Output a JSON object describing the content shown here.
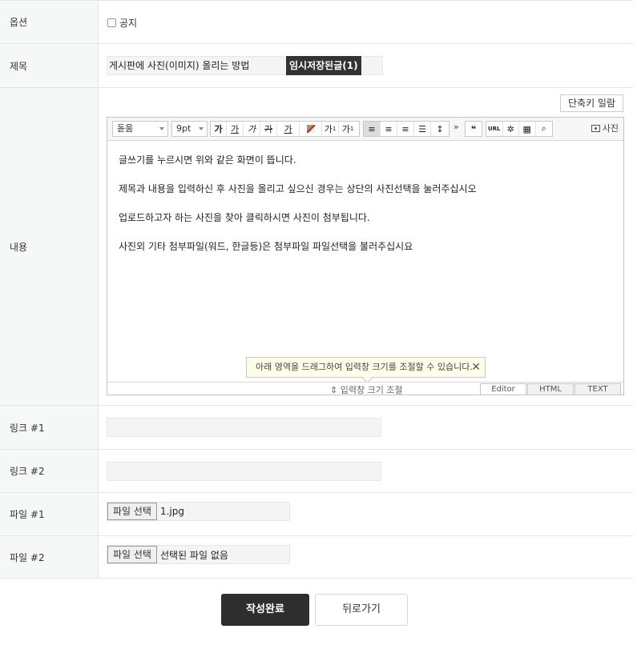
{
  "form": {
    "option": {
      "label": "옵션",
      "notice_label": "공지"
    },
    "subject": {
      "label": "제목",
      "value": "게시판에 사진(이미지) 올리는 방법",
      "temp_button": "임시저장된글(1)"
    },
    "content": {
      "label": "내용",
      "shortcut_button": "단축키 일람",
      "toolbar": {
        "font": "돋움",
        "size": "9pt",
        "bold": "가",
        "underline": "가",
        "italic": "가",
        "strike": "가",
        "font_color": "가",
        "superscript": "가",
        "subscript": "가",
        "more": "»",
        "quote": "❝",
        "url": "URL",
        "photo": "사진"
      },
      "body": [
        "글쓰기를 누르시면 위와 같은 화면이 뜹니다.",
        "제목과 내용을 입력하신 후 사진을 올리고 싶으신 경우는 상단의 사진선택을 눌러주십시오",
        "업로드하고자 하는 사진을 찾아 클릭하시면 사진이 첨부됩니다.",
        "사진외 기타 첨부파일(워드, 한글등)은 첨부파일 파일선택을 불러주십시요"
      ],
      "tip": "아래 영역을 드래그하여 입력창 크기를 조절할 수 있습니다.",
      "resize_label": "⇕ 입력창 크기 조절",
      "modes": [
        "Editor",
        "HTML",
        "TEXT"
      ]
    },
    "link1": {
      "label": "링크 #1",
      "value": ""
    },
    "link2": {
      "label": "링크 #2",
      "value": ""
    },
    "file1": {
      "label": "파일 #1",
      "button": "파일 선택",
      "filename": "1.jpg"
    },
    "file2": {
      "label": "파일 #2",
      "button": "파일 선택",
      "filename": "선택된 파일 없음"
    }
  },
  "actions": {
    "submit": "작성완료",
    "back": "뒤로가기"
  }
}
